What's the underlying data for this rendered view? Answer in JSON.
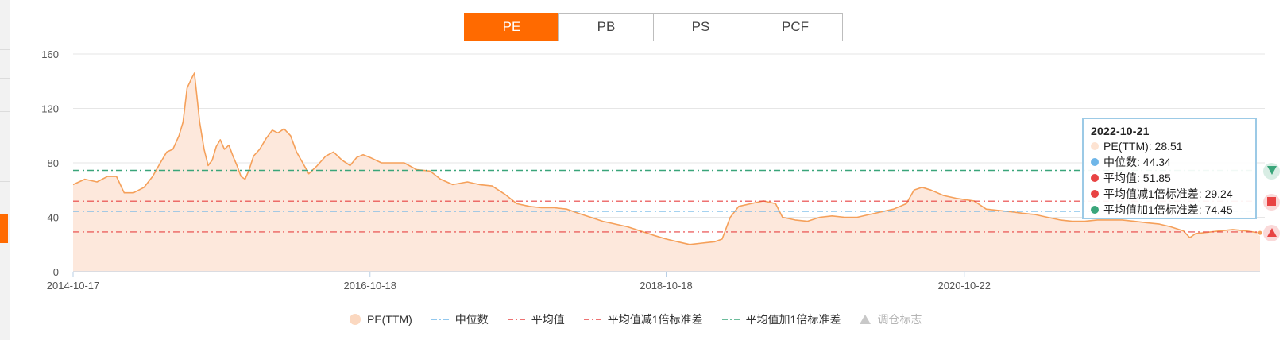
{
  "tabs": [
    {
      "label": "PE",
      "active": true
    },
    {
      "label": "PB",
      "active": false
    },
    {
      "label": "PS",
      "active": false
    },
    {
      "label": "PCF",
      "active": false
    }
  ],
  "tooltip": {
    "date": "2022-10-21",
    "rows": [
      {
        "text": "PE(TTM): 28.51",
        "color": "#fde3d2"
      },
      {
        "text": "中位数: 44.34",
        "color": "#6fb6e8"
      },
      {
        "text": "平均值: 51.85",
        "color": "#e84343"
      },
      {
        "text": "平均值减1倍标准差: 29.24",
        "color": "#e84343"
      },
      {
        "text": "平均值加1倍标准差: 74.45",
        "color": "#3aa57a"
      }
    ]
  },
  "legend": [
    {
      "label": "PE(TTM)",
      "symbol": "circle",
      "color": "#fbd8c0",
      "dim": false
    },
    {
      "label": "中位数",
      "symbol": "dashdot",
      "color": "#6fb6e8",
      "dim": false
    },
    {
      "label": "平均值",
      "symbol": "dashdot",
      "color": "#e84343",
      "dim": false
    },
    {
      "label": "平均值减1倍标准差",
      "symbol": "dashdot",
      "color": "#e84343",
      "dim": false
    },
    {
      "label": "平均值加1倍标准差",
      "symbol": "dashdot",
      "color": "#3aa57a",
      "dim": false
    },
    {
      "label": "调仓标志",
      "symbol": "triangle",
      "color": "#c8c8c8",
      "dim": true
    }
  ],
  "side_buttons": [
    {
      "name": "plus-1sd-marker",
      "shape": "triangle-down",
      "color": "#3aa57a"
    },
    {
      "name": "mean-marker",
      "shape": "square",
      "color": "#e84343"
    },
    {
      "name": "minus-1sd-marker",
      "shape": "triangle-up",
      "color": "#e84343"
    }
  ],
  "colors": {
    "accent": "#ff6a00",
    "line": "#f5a05a",
    "area": "#fde8dc",
    "median": "#6fb6e8",
    "mean": "#e84343",
    "plus_sd": "#3aa57a"
  },
  "chart_data": {
    "type": "area",
    "title": "",
    "xlabel": "",
    "ylabel": "",
    "ylim": [
      0,
      160
    ],
    "yticks": [
      0,
      40,
      80,
      120,
      160
    ],
    "xticks": [
      "2014-10-17",
      "2016-10-18",
      "2018-10-18",
      "2020-10-22"
    ],
    "x_range": [
      "2014-10-17",
      "2022-10-21"
    ],
    "grid": true,
    "legend_position": "bottom",
    "series": [
      {
        "name": "PE(TTM)",
        "type": "area",
        "points": [
          [
            "2014-10-17",
            64
          ],
          [
            "2014-11-15",
            68
          ],
          [
            "2014-12-15",
            66
          ],
          [
            "2015-01-10",
            70
          ],
          [
            "2015-02-01",
            70
          ],
          [
            "2015-02-20",
            58
          ],
          [
            "2015-03-15",
            58
          ],
          [
            "2015-04-10",
            62
          ],
          [
            "2015-05-01",
            70
          ],
          [
            "2015-05-20",
            80
          ],
          [
            "2015-06-05",
            88
          ],
          [
            "2015-06-20",
            90
          ],
          [
            "2015-07-05",
            100
          ],
          [
            "2015-07-15",
            110
          ],
          [
            "2015-07-25",
            135
          ],
          [
            "2015-08-05",
            142
          ],
          [
            "2015-08-12",
            146
          ],
          [
            "2015-08-18",
            130
          ],
          [
            "2015-08-25",
            110
          ],
          [
            "2015-09-05",
            90
          ],
          [
            "2015-09-15",
            78
          ],
          [
            "2015-09-25",
            82
          ],
          [
            "2015-10-05",
            92
          ],
          [
            "2015-10-15",
            97
          ],
          [
            "2015-10-25",
            90
          ],
          [
            "2015-11-05",
            93
          ],
          [
            "2015-11-15",
            85
          ],
          [
            "2015-11-25",
            78
          ],
          [
            "2015-12-05",
            70
          ],
          [
            "2015-12-15",
            68
          ],
          [
            "2015-12-25",
            75
          ],
          [
            "2016-01-05",
            85
          ],
          [
            "2016-01-20",
            90
          ],
          [
            "2016-02-05",
            98
          ],
          [
            "2016-02-20",
            104
          ],
          [
            "2016-03-05",
            102
          ],
          [
            "2016-03-20",
            105
          ],
          [
            "2016-04-05",
            100
          ],
          [
            "2016-04-20",
            88
          ],
          [
            "2016-05-05",
            80
          ],
          [
            "2016-05-20",
            72
          ],
          [
            "2016-06-10",
            78
          ],
          [
            "2016-07-01",
            85
          ],
          [
            "2016-07-20",
            88
          ],
          [
            "2016-08-10",
            82
          ],
          [
            "2016-08-30",
            78
          ],
          [
            "2016-09-15",
            84
          ],
          [
            "2016-10-01",
            86
          ],
          [
            "2016-10-18",
            84
          ],
          [
            "2016-11-15",
            80
          ],
          [
            "2016-12-15",
            80
          ],
          [
            "2017-01-10",
            80
          ],
          [
            "2017-02-10",
            75
          ],
          [
            "2017-03-15",
            74
          ],
          [
            "2017-04-10",
            68
          ],
          [
            "2017-05-10",
            64
          ],
          [
            "2017-06-15",
            66
          ],
          [
            "2017-07-15",
            64
          ],
          [
            "2017-08-15",
            63
          ],
          [
            "2017-09-15",
            57
          ],
          [
            "2017-10-15",
            50
          ],
          [
            "2017-11-15",
            48
          ],
          [
            "2017-12-15",
            47
          ],
          [
            "2018-01-15",
            47
          ],
          [
            "2018-02-15",
            46
          ],
          [
            "2018-03-15",
            43
          ],
          [
            "2018-04-15",
            40
          ],
          [
            "2018-05-15",
            37
          ],
          [
            "2018-06-15",
            35
          ],
          [
            "2018-07-15",
            33
          ],
          [
            "2018-08-15",
            30
          ],
          [
            "2018-09-15",
            27
          ],
          [
            "2018-10-18",
            24
          ],
          [
            "2018-11-15",
            22
          ],
          [
            "2018-12-15",
            20
          ],
          [
            "2019-01-15",
            21
          ],
          [
            "2019-02-15",
            22
          ],
          [
            "2019-03-05",
            24
          ],
          [
            "2019-03-25",
            40
          ],
          [
            "2019-04-15",
            48
          ],
          [
            "2019-05-15",
            50
          ],
          [
            "2019-06-15",
            52
          ],
          [
            "2019-07-15",
            50
          ],
          [
            "2019-08-01",
            40
          ],
          [
            "2019-09-01",
            38
          ],
          [
            "2019-10-01",
            37
          ],
          [
            "2019-11-01",
            40
          ],
          [
            "2019-12-01",
            41
          ],
          [
            "2020-01-01",
            40
          ],
          [
            "2020-02-01",
            40
          ],
          [
            "2020-03-01",
            42
          ],
          [
            "2020-04-01",
            44
          ],
          [
            "2020-05-01",
            46
          ],
          [
            "2020-06-01",
            50
          ],
          [
            "2020-06-20",
            60
          ],
          [
            "2020-07-10",
            62
          ],
          [
            "2020-08-01",
            60
          ],
          [
            "2020-09-01",
            56
          ],
          [
            "2020-10-01",
            54
          ],
          [
            "2020-10-22",
            53
          ],
          [
            "2020-11-15",
            52
          ],
          [
            "2020-12-15",
            46
          ],
          [
            "2021-01-15",
            45
          ],
          [
            "2021-02-15",
            44
          ],
          [
            "2021-03-15",
            43
          ],
          [
            "2021-04-15",
            42
          ],
          [
            "2021-05-15",
            40
          ],
          [
            "2021-06-15",
            38
          ],
          [
            "2021-07-15",
            37
          ],
          [
            "2021-08-15",
            37
          ],
          [
            "2021-09-15",
            38
          ],
          [
            "2021-10-15",
            38
          ],
          [
            "2021-11-15",
            38
          ],
          [
            "2021-12-15",
            37
          ],
          [
            "2022-01-15",
            36
          ],
          [
            "2022-02-15",
            35
          ],
          [
            "2022-03-15",
            33
          ],
          [
            "2022-04-15",
            30
          ],
          [
            "2022-05-01",
            25
          ],
          [
            "2022-05-15",
            28
          ],
          [
            "2022-06-15",
            29
          ],
          [
            "2022-07-15",
            30
          ],
          [
            "2022-08-15",
            31
          ],
          [
            "2022-09-15",
            30
          ],
          [
            "2022-10-21",
            28.51
          ]
        ]
      },
      {
        "name": "中位数",
        "type": "hline",
        "value": 44.34
      },
      {
        "name": "平均值",
        "type": "hline",
        "value": 51.85
      },
      {
        "name": "平均值减1倍标准差",
        "type": "hline",
        "value": 29.24
      },
      {
        "name": "平均值加1倍标准差",
        "type": "hline",
        "value": 74.45
      }
    ]
  }
}
